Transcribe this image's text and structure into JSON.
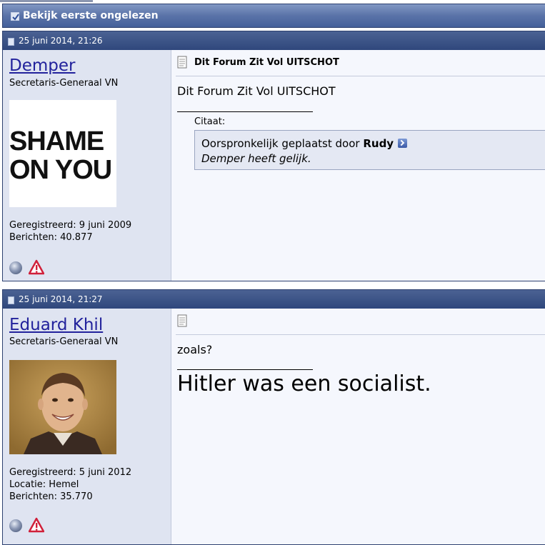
{
  "toolbar": {
    "first_unread_label": "Bekijk eerste ongelezen"
  },
  "posts": [
    {
      "date": "25 juni 2014, 21:26",
      "username": "Demper",
      "usertitle": "Secretaris-Generaal VN",
      "avatar_text": [
        "SHAME",
        "ON YOU"
      ],
      "info": [
        "Geregistreerd: 9 juni 2009",
        "Berichten: 40.877"
      ],
      "title": "Dit Forum Zit Vol UITSCHOT",
      "body": "Dit Forum Zit Vol UITSCHOT",
      "quote": {
        "label": "Citaat:",
        "prefix": "Oorspronkelijk geplaatst door",
        "author": "Rudy",
        "text": "Demper heeft gelijk."
      }
    },
    {
      "date": "25 juni 2014, 21:27",
      "username": "Eduard Khil",
      "usertitle": "Secretaris-Generaal VN",
      "info": [
        "Geregistreerd: 5 juni 2012",
        "Locatie: Hemel",
        "Berichten: 35.770"
      ],
      "body": "zoals?",
      "signature": "Hitler was een socialist."
    }
  ],
  "icons": {
    "status": "offline-status-icon",
    "report": "report-warning-icon",
    "post": "post-document-icon",
    "view_post": "view-post-arrow-icon"
  }
}
